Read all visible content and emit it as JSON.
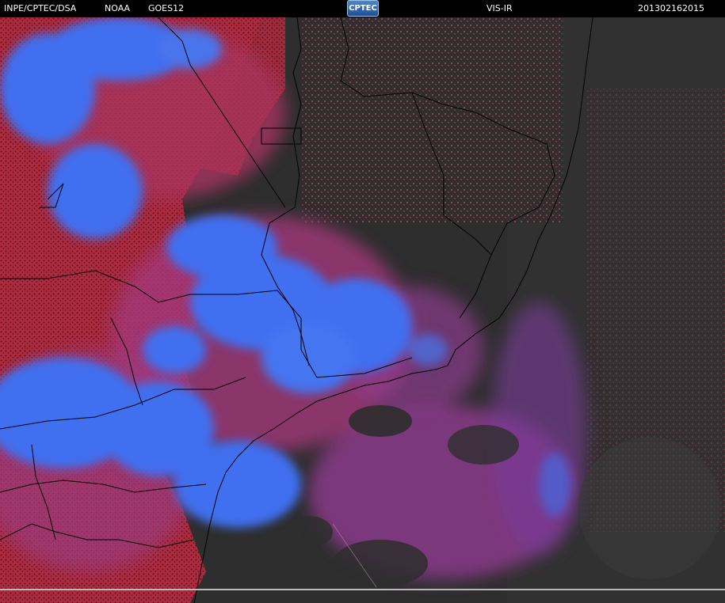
{
  "header": {
    "org": "INPE/CPTEC/DSA",
    "agency": "NOAA",
    "satellite": "GOES12",
    "logo_text": "CPTEC",
    "product": "VIS-IR",
    "timestamp": "201302162015"
  },
  "colors": {
    "background": "#000000",
    "land_dark": "#2e2e2e",
    "warm_cloud_red": "#c8324a",
    "cold_cloud_blue": "#3f6ff0",
    "boundary_lines": "#000000"
  }
}
